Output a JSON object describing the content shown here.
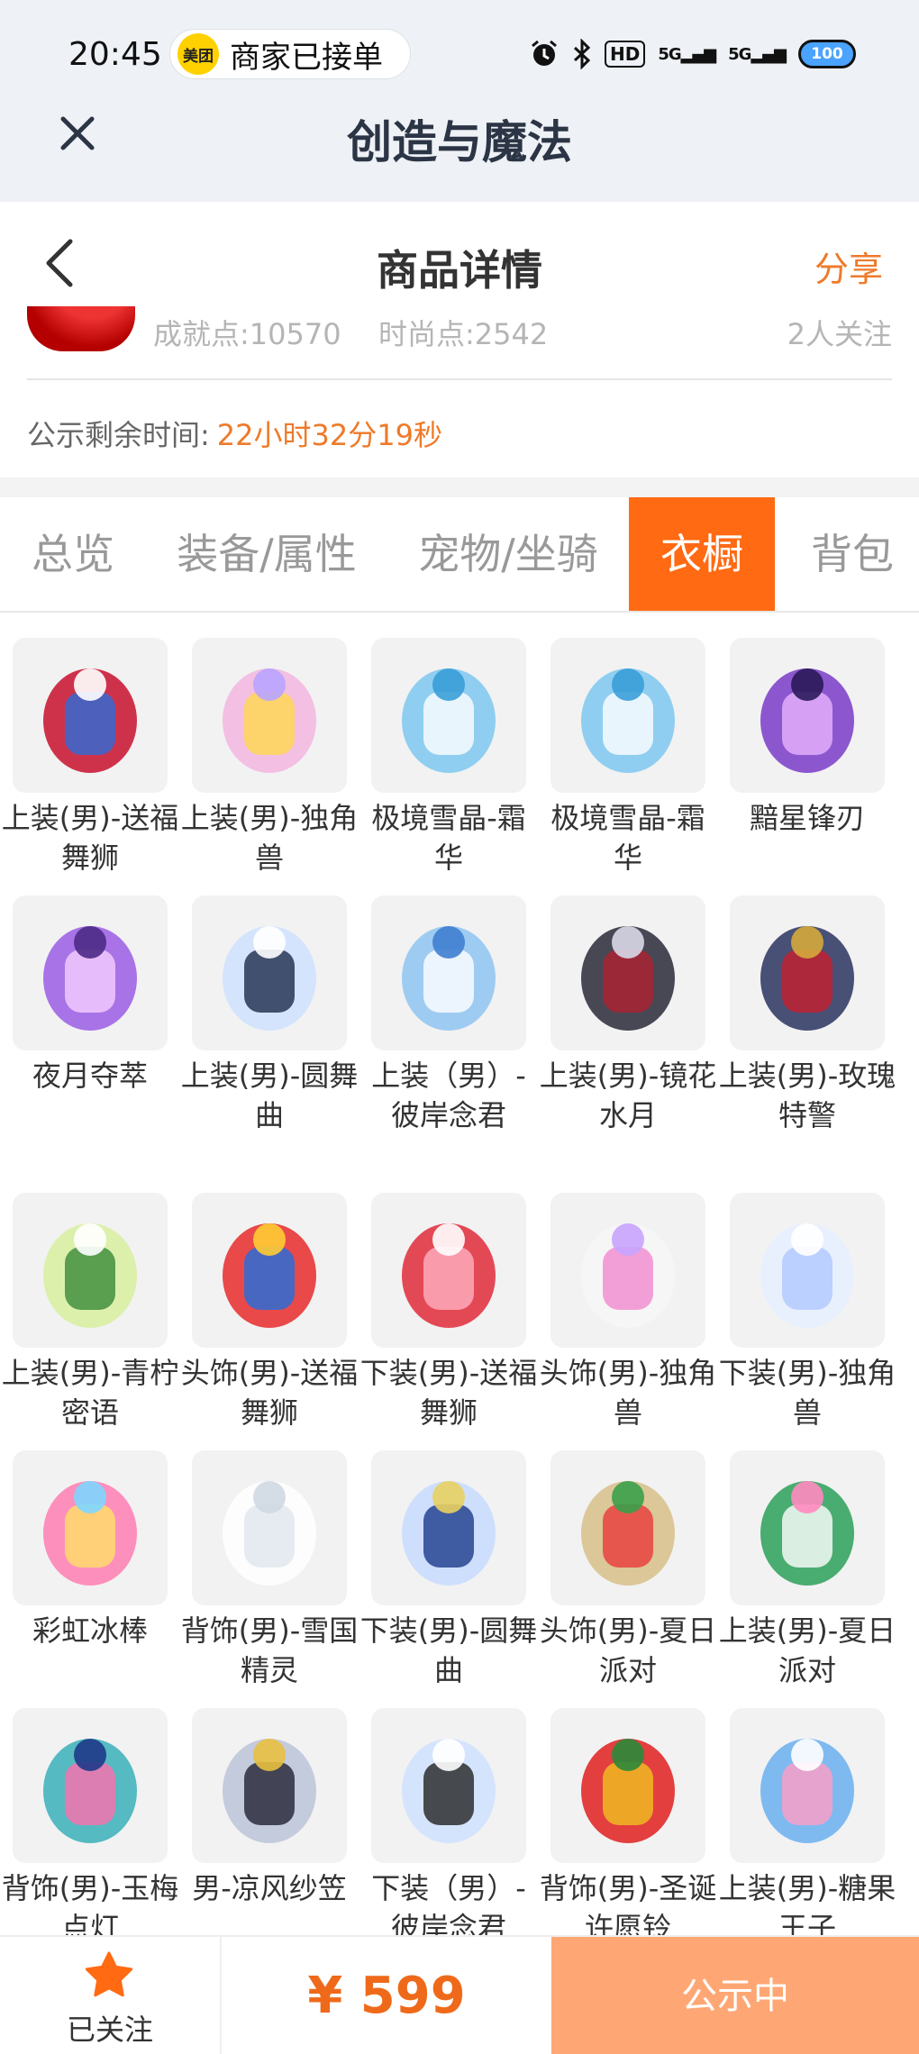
{
  "status_bar": {
    "time": "20:45",
    "meituan_logo": "美团",
    "meituan_status": "商家已接单",
    "icons": [
      "alarm-icon",
      "bluetooth-icon",
      "hd-icon",
      "signal-5g-icon",
      "signal-5g-icon",
      "battery-icon"
    ],
    "hd": "HD",
    "net1": "5G",
    "net2": "5G",
    "battery": "100"
  },
  "mini_program": {
    "title": "创造与魔法",
    "close_icon": "close-icon"
  },
  "nav": {
    "title": "商品详情",
    "share": "分享",
    "back_icon": "back-arrow-icon"
  },
  "stats": {
    "achievement": "成就点:10570",
    "fashion": "时尚点:2542",
    "followers": "2人关注"
  },
  "countdown": {
    "label": "公示剩余时间:",
    "value": "22小时32分19秒"
  },
  "tabs": [
    {
      "label": "总览",
      "active": false
    },
    {
      "label": "装备/属性",
      "active": false
    },
    {
      "label": "宠物/坐骑",
      "active": false
    },
    {
      "label": "衣橱",
      "active": true
    },
    {
      "label": "背包",
      "active": false
    }
  ],
  "wardrobe": [
    {
      "label": "上装(男)-送福舞狮",
      "icon": "lion-dance-top"
    },
    {
      "label": "上装(男)-独角兽",
      "icon": "unicorn-top"
    },
    {
      "label": "极境雪晶-霜华",
      "icon": "ice-bow"
    },
    {
      "label": "极境雪晶-霜华",
      "icon": "ice-bow"
    },
    {
      "label": "黯星锋刃",
      "icon": "purple-blade"
    },
    {
      "label": "夜月夺萃",
      "icon": "purple-scythe"
    },
    {
      "label": "上装(男)-圆舞曲",
      "icon": "waltz-top"
    },
    {
      "label": "上装（男）-彼岸念君",
      "icon": "blue-robe"
    },
    {
      "label": "上装(男)-镜花水月",
      "icon": "dark-top"
    },
    {
      "label": "上装(男)-玫瑰特警",
      "icon": "navy-uniform"
    },
    {
      "label": "上装(男)-青柠密语",
      "icon": "lime-top"
    },
    {
      "label": "头饰(男)-送福舞狮",
      "icon": "lion-hat"
    },
    {
      "label": "下装(男)-送福舞狮",
      "icon": "red-pants"
    },
    {
      "label": "头饰(男)-独角兽",
      "icon": "unicorn-hood"
    },
    {
      "label": "下装(男)-独角兽",
      "icon": "white-shoes"
    },
    {
      "label": "彩虹冰棒",
      "icon": "rainbow-popsicle"
    },
    {
      "label": "背饰(男)-雪国精灵",
      "icon": "white-wings"
    },
    {
      "label": "下装(男)-圆舞曲",
      "icon": "light-shorts"
    },
    {
      "label": "头饰(男)-夏日派对",
      "icon": "straw-hat"
    },
    {
      "label": "上装(男)-夏日派对",
      "icon": "summer-shirt"
    },
    {
      "label": "背饰(男)-玉梅点灯",
      "icon": "lantern"
    },
    {
      "label": "男-凉风纱笠",
      "icon": "veil-hat"
    },
    {
      "label": "下装（男）-彼岸念君",
      "icon": "blue-pants"
    },
    {
      "label": "背饰(男)-圣诞许愿铃",
      "icon": "christmas-bells"
    },
    {
      "label": "上装(男)-糖果王子",
      "icon": "candy-prince"
    }
  ],
  "bottom": {
    "follow_label": "已关注",
    "price": "¥ 599",
    "cta": "公示中",
    "star_icon": "star-icon"
  },
  "colors": {
    "accent": "#ff6a13",
    "price": "#ee6a1a",
    "cta_bg": "#ffa774",
    "share": "#ee7a2a"
  }
}
